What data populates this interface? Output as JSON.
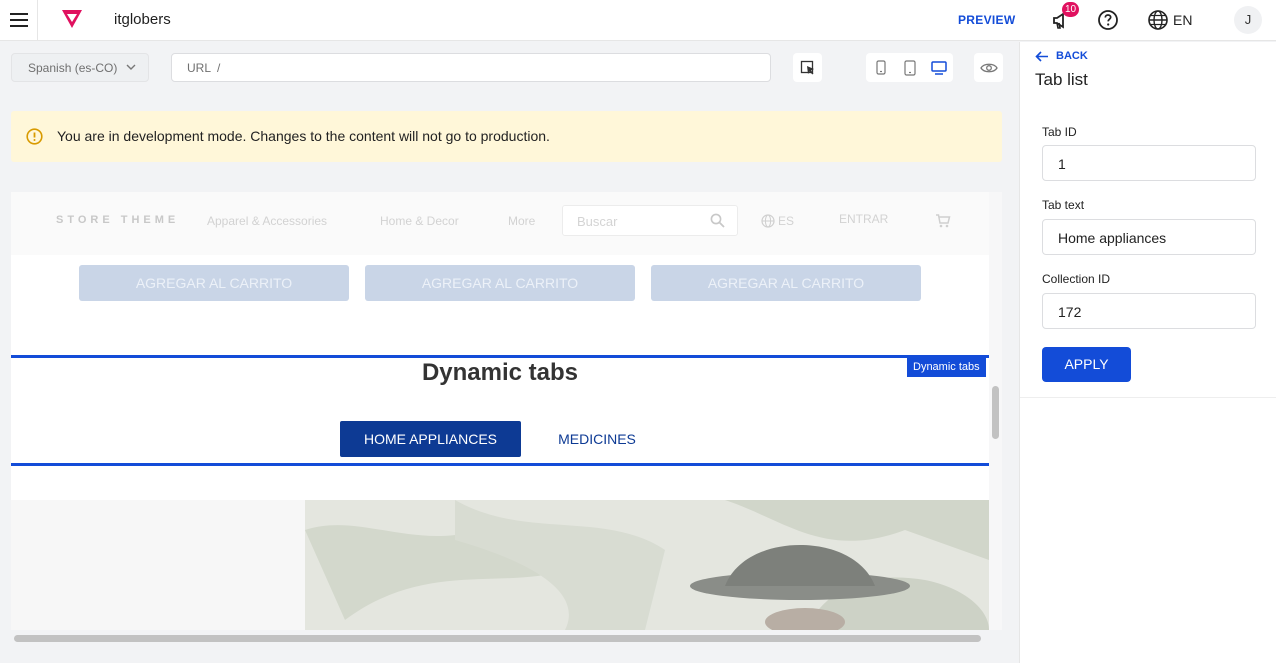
{
  "topbar": {
    "account_name": "itglobers",
    "preview_label": "PREVIEW",
    "notification_count": "10",
    "language": "EN",
    "user_initial": "J"
  },
  "toolbar": {
    "locale": "Spanish (es-CO)",
    "url_label": "URL",
    "url_value": "/"
  },
  "banner": {
    "message": "You are in development mode. Changes to the content will not go to production."
  },
  "store": {
    "brand": "STORE THEME",
    "nav": [
      "Apparel & Accessories",
      "Home & Decor",
      "More"
    ],
    "search_placeholder": "Buscar",
    "language": "ES",
    "login": "ENTRAR",
    "cart_buttons": [
      "AGREGAR AL CARRITO",
      "AGREGAR AL CARRITO",
      "AGREGAR AL CARRITO"
    ]
  },
  "dynamic_tabs": {
    "tag": "Dynamic tabs",
    "title": "Dynamic tabs",
    "tabs": [
      "HOME APPLIANCES",
      "MEDICINES"
    ]
  },
  "panel": {
    "back_label": "BACK",
    "title": "Tab list",
    "fields": [
      {
        "label": "Tab ID",
        "value": "1"
      },
      {
        "label": "Tab text",
        "value": "Home appliances"
      },
      {
        "label": "Collection ID",
        "value": "172"
      }
    ],
    "apply_label": "APPLY"
  },
  "colors": {
    "accent": "#134cd8",
    "tab_active": "#0d3a94",
    "badge": "#e0115f",
    "banner_bg": "#fff7d9"
  }
}
